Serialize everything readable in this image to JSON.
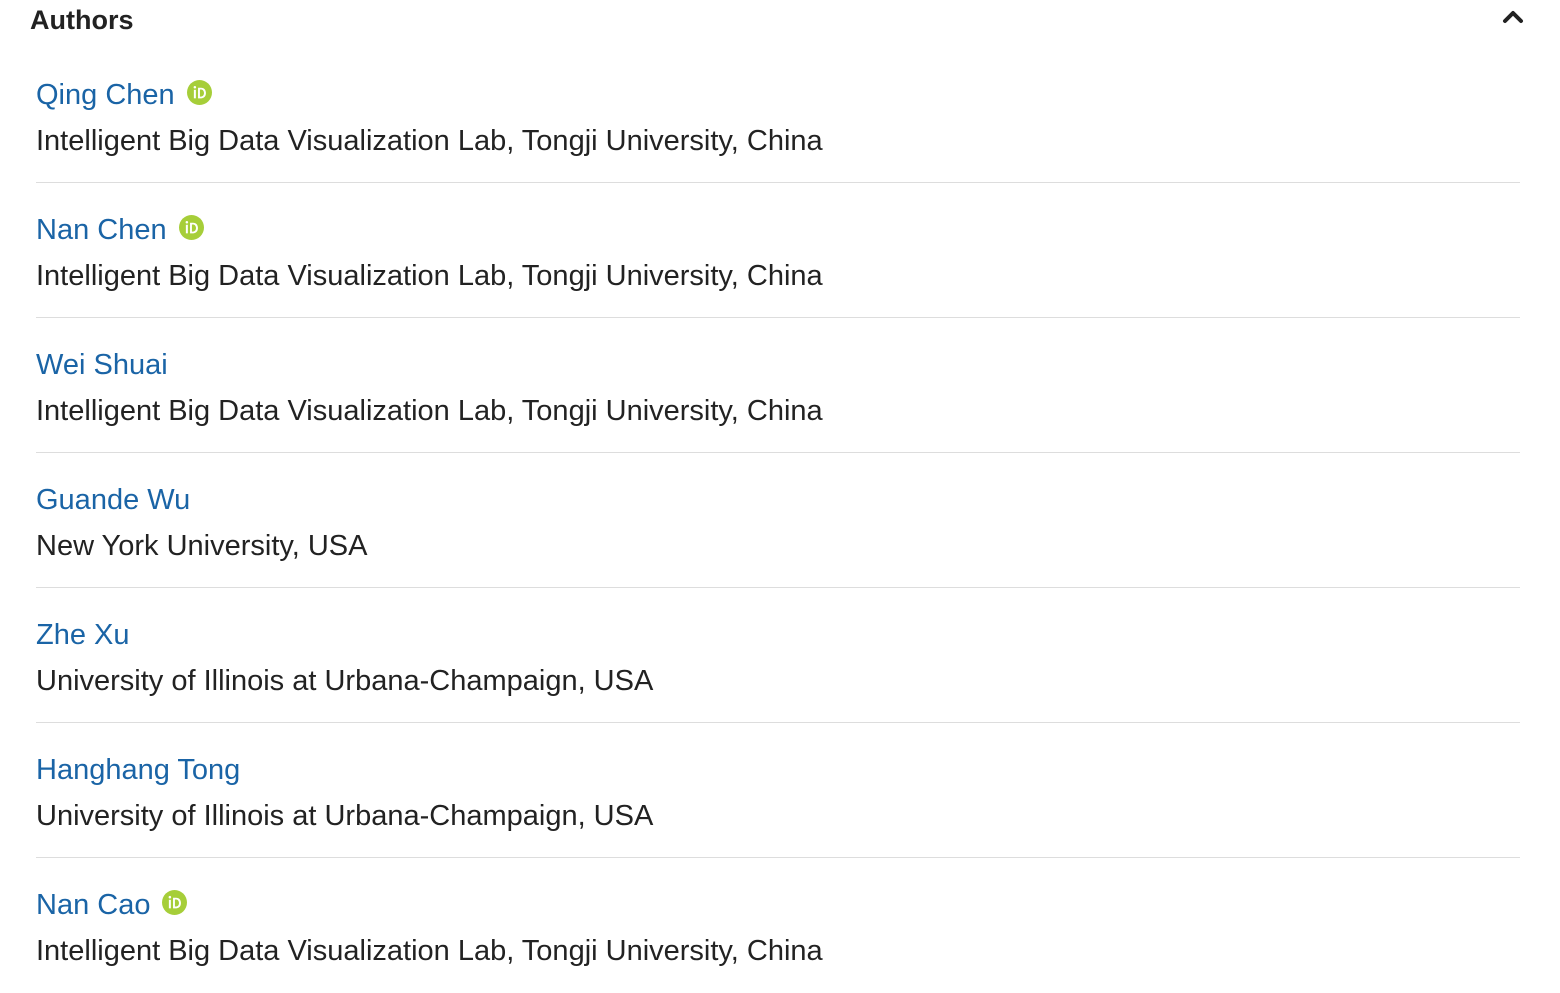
{
  "section": {
    "title": "Authors",
    "collapse_icon": "chevron-up-icon"
  },
  "authors": [
    {
      "name": "Qing Chen",
      "affiliation": "Intelligent Big Data Visualization Lab, Tongji University, China",
      "orcid": true
    },
    {
      "name": "Nan Chen",
      "affiliation": "Intelligent Big Data Visualization Lab, Tongji University, China",
      "orcid": true
    },
    {
      "name": "Wei Shuai",
      "affiliation": "Intelligent Big Data Visualization Lab, Tongji University, China",
      "orcid": false
    },
    {
      "name": "Guande Wu",
      "affiliation": "New York University, USA",
      "orcid": false
    },
    {
      "name": "Zhe Xu",
      "affiliation": "University of Illinois at Urbana-Champaign, USA",
      "orcid": false
    },
    {
      "name": "Hanghang Tong",
      "affiliation": "University of Illinois at Urbana-Champaign, USA",
      "orcid": false
    },
    {
      "name": "Nan Cao",
      "affiliation": "Intelligent Big Data Visualization Lab, Tongji University, China",
      "orcid": true
    }
  ],
  "colors": {
    "link": "#1a64a6",
    "text": "#222222",
    "orcid": "#a6ce39",
    "divider": "#dddddd"
  }
}
